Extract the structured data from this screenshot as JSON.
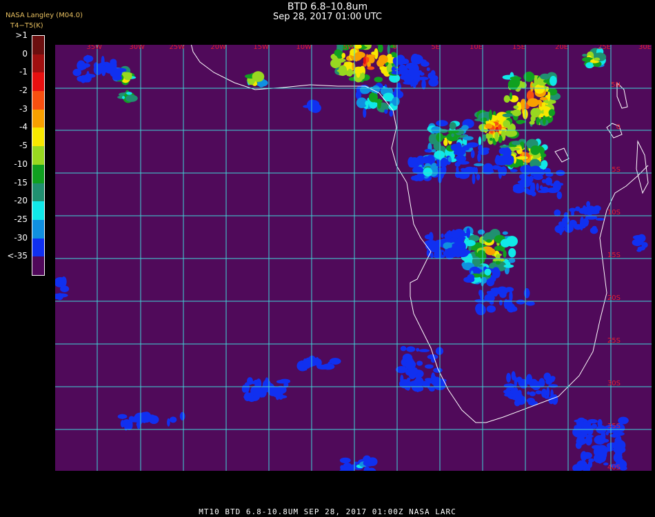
{
  "header": {
    "title": "BTD 6.8–10.8um",
    "datetime": "Sep 28, 2017 01:00 UTC",
    "credit": "NASA Langley (M04.0)",
    "unit_label": "T4−T5(K)"
  },
  "legend": {
    "entries": [
      {
        "label": ">1",
        "color": "#6b0f0f"
      },
      {
        "label": "0",
        "color": "#a01010"
      },
      {
        "label": "-1",
        "color": "#e81010"
      },
      {
        "label": "-2",
        "color": "#f85010"
      },
      {
        "label": "-3",
        "color": "#f8a000"
      },
      {
        "label": "-4",
        "color": "#f8e800"
      },
      {
        "label": "-5",
        "color": "#98d820"
      },
      {
        "label": "-10",
        "color": "#10a020"
      },
      {
        "label": "-15",
        "color": "#209070"
      },
      {
        "label": "-20",
        "color": "#10e8e8"
      },
      {
        "label": "-25",
        "color": "#1090e0"
      },
      {
        "label": "-30",
        "color": "#1030f0"
      },
      {
        "label": "<-35",
        "color": "#50085a"
      }
    ]
  },
  "map": {
    "background_color": "#500a5a",
    "grid_color": "#40d8d8",
    "coast_color": "#ffffff",
    "lon_labels": [
      "35W",
      "30W",
      "25W",
      "20W",
      "15W",
      "10W",
      "5W",
      "0",
      "5E",
      "10E",
      "15E",
      "20E",
      "25E",
      "30E",
      "35E"
    ],
    "lat_labels": [
      "5N",
      "0",
      "5S",
      "10S",
      "15S",
      "20S",
      "25S",
      "30S",
      "35S",
      "40S"
    ],
    "label_color": "#e02030"
  },
  "footer": {
    "text": "MT10  BTD 6.8-10.8UM   SEP 28, 2017 01:00Z   NASA LARC"
  }
}
